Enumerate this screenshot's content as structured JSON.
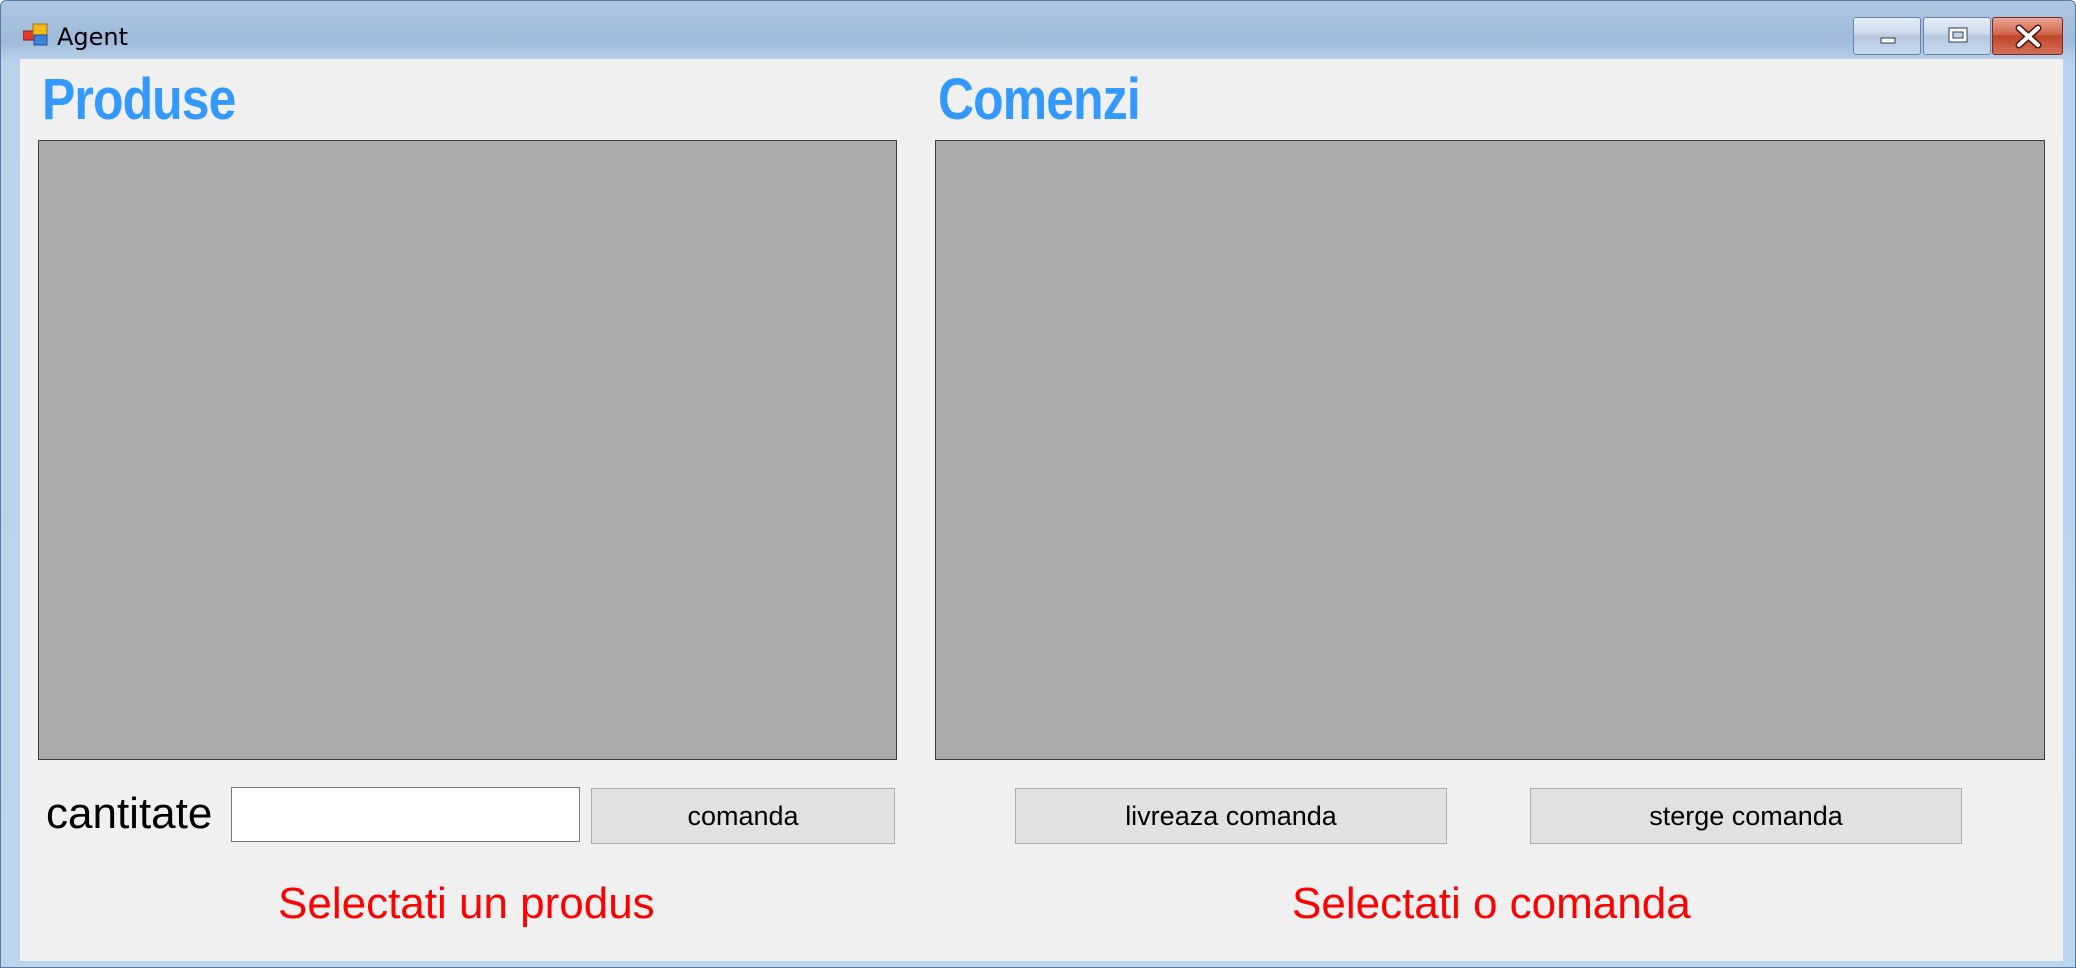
{
  "window": {
    "title": "Agent",
    "controls": {
      "minimize": "minimize-icon",
      "maximize": "maximize-icon",
      "close": "close-icon"
    }
  },
  "produse": {
    "heading": "Produse",
    "quantity_label": "cantitate",
    "quantity_value": "",
    "order_button": "comanda",
    "status": "Selectati un produs"
  },
  "comenzi": {
    "heading": "Comenzi",
    "deliver_button": "livreaza comanda",
    "delete_button": "sterge comanda",
    "status": "Selectati o comanda"
  },
  "colors": {
    "heading": "#3399ff",
    "status": "#ff0000",
    "panel": "#ababab",
    "client_background": "#f0f0f0"
  }
}
